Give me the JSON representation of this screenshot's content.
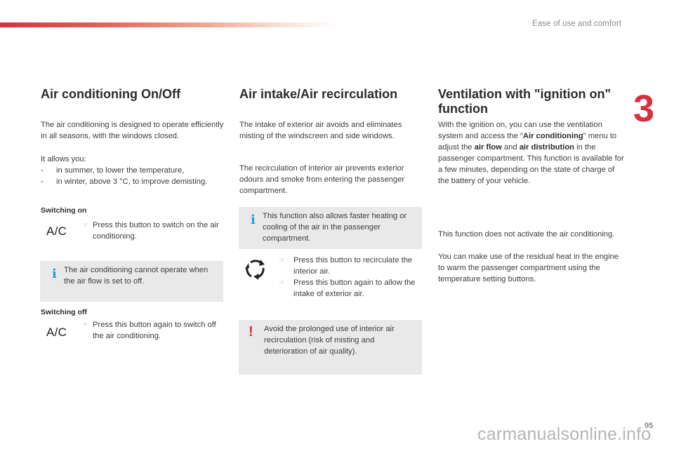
{
  "header": {
    "chapter_title": "Ease of use and comfort",
    "chapter_number": "3",
    "accent_color": "#d9303e"
  },
  "col1": {
    "title": "Air conditioning On/Off",
    "intro": "The air conditioning is designed to operate efficiently in all seasons, with the windows closed.",
    "allows_label": "It allows you:",
    "allows_items": [
      "in summer, to lower the temperature,",
      "in winter, above 3 °C, to improve demisting."
    ],
    "list_marker": "-",
    "switching_on": {
      "heading": "Switching on",
      "button_label": "A/C",
      "steps": [
        "Press this button to switch on the air conditioning."
      ]
    },
    "info_note": "The air conditioning cannot operate when the air flow is set to off.",
    "switching_off": {
      "heading": "Switching off",
      "button_label": "A/C",
      "steps": [
        "Press this button again to switch off the air conditioning."
      ]
    }
  },
  "col2": {
    "title": "Air intake/Air recirculation",
    "para1": "The intake of exterior air avoids and eliminates misting of the windscreen and side windows.",
    "para2": "The recirculation of interior air prevents exterior odours and smoke from entering the passenger compartment.",
    "info_note": "This function also allows faster heating or cooling of the air in the passenger compartment.",
    "steps": [
      "Press this button to recirculate the interior air.",
      "Press this button again to allow the intake of exterior air."
    ],
    "warning_note": "Avoid the prolonged use of interior air recirculation (risk of misting and deterioration of air quality)."
  },
  "col3": {
    "title": "Ventilation with \"ignition on\" function",
    "para1": {
      "t1": "With the ignition on, you can use the ventilation system and access the \"",
      "b1": "Air conditioning",
      "t2": "\" menu to adjust the ",
      "b2": "air flow",
      "t3": " and ",
      "b3": "air distribution",
      "t4": " in the passenger compartment. This function is available for a few minutes, depending on the state of charge of the battery of your vehicle."
    },
    "para2": "This function does not activate the air conditioning.",
    "para3": "You can make use of the residual heat in the engine to warm the passenger compartment using the temperature setting buttons."
  },
  "icons": {
    "bullet": "☞",
    "info": "i",
    "warning": "!"
  },
  "footer": {
    "page_number": "95",
    "watermark": "carmanualsonline.info"
  }
}
